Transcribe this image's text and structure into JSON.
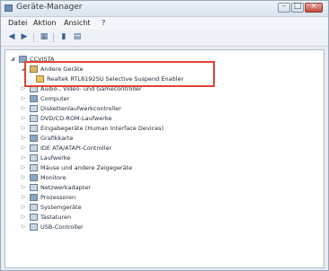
{
  "window": {
    "title": "Geräte-Manager"
  },
  "menu": {
    "items": [
      "Datei",
      "Aktion",
      "Ansicht",
      "?"
    ]
  },
  "toolbar": {
    "buttons": [
      "back",
      "forward",
      "properties",
      "help",
      "view"
    ]
  },
  "tree": {
    "root": "CCVISTA",
    "nodes": [
      {
        "label": "Andere Geräte",
        "level": 1,
        "expanded": true,
        "icon": "other-devices-icon"
      },
      {
        "label": "Realtek RTL8192SU Selective Suspend Enabler",
        "level": 2,
        "expanded": null,
        "icon": "warning-device-icon"
      },
      {
        "label": "Audio-, Video- und Gamecontroller",
        "level": 1,
        "expanded": false,
        "icon": "audio-icon"
      },
      {
        "label": "Computer",
        "level": 1,
        "expanded": false,
        "icon": "computer-icon"
      },
      {
        "label": "Diskettenlaufwerkcontroller",
        "level": 1,
        "expanded": false,
        "icon": "floppy-controller-icon"
      },
      {
        "label": "DVD/CD-ROM-Laufwerke",
        "level": 1,
        "expanded": false,
        "icon": "dvd-icon"
      },
      {
        "label": "Eingabegeräte (Human Interface Devices)",
        "level": 1,
        "expanded": false,
        "icon": "hid-icon"
      },
      {
        "label": "Grafikkarte",
        "level": 1,
        "expanded": false,
        "icon": "graphics-icon"
      },
      {
        "label": "IDE ATA/ATAPI-Controller",
        "level": 1,
        "expanded": false,
        "icon": "ide-icon"
      },
      {
        "label": "Laufwerke",
        "level": 1,
        "expanded": false,
        "icon": "drive-icon"
      },
      {
        "label": "Mäuse und andere Zeigegeräte",
        "level": 1,
        "expanded": false,
        "icon": "mouse-icon"
      },
      {
        "label": "Monitore",
        "level": 1,
        "expanded": false,
        "icon": "monitor-icon"
      },
      {
        "label": "Netzwerkadapter",
        "level": 1,
        "expanded": false,
        "icon": "network-icon"
      },
      {
        "label": "Prozessoren",
        "level": 1,
        "expanded": false,
        "icon": "processor-icon"
      },
      {
        "label": "Systemgeräte",
        "level": 1,
        "expanded": false,
        "icon": "system-icon"
      },
      {
        "label": "Tastaturen",
        "level": 1,
        "expanded": false,
        "icon": "keyboard-icon"
      },
      {
        "label": "USB-Controller",
        "level": 1,
        "expanded": false,
        "icon": "usb-icon"
      }
    ]
  },
  "colors": {
    "highlight": "#e0432f"
  }
}
